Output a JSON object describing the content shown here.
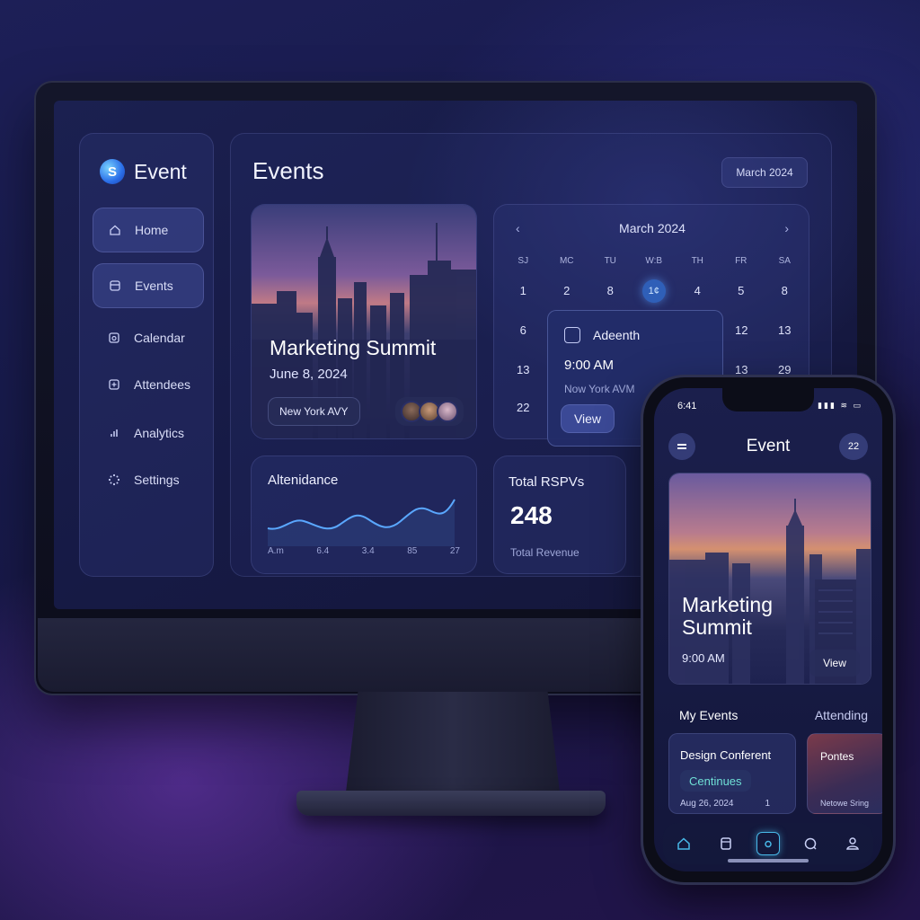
{
  "desktop": {
    "brand": {
      "logo_letter": "S",
      "name": "Event"
    },
    "sidebar": {
      "items": [
        {
          "label": "Home",
          "icon": "home-icon"
        },
        {
          "label": "Events",
          "icon": "events-icon"
        },
        {
          "label": "Calendar",
          "icon": "calendar-icon"
        },
        {
          "label": "Attendees",
          "icon": "attendees-icon"
        },
        {
          "label": "Analytics",
          "icon": "analytics-icon"
        },
        {
          "label": "Settings",
          "icon": "settings-icon"
        }
      ]
    },
    "header": {
      "title": "Events",
      "month_chip": "March 2024"
    },
    "featured_event": {
      "title": "Marketing Summit",
      "date": "June 8, 2024",
      "location": "New York AVY"
    },
    "calendar": {
      "month": "March 2024",
      "prev_icon": "‹",
      "next_icon": "›",
      "weekdays": [
        "SJ",
        "MC",
        "TU",
        "W:B",
        "TH",
        "FR",
        "SA"
      ],
      "row1": [
        "1",
        "2",
        "8",
        "1¢",
        "4",
        "5",
        "8"
      ],
      "left_col": [
        "6",
        "13",
        "22"
      ],
      "right_col_fr": [
        "12",
        "13"
      ],
      "right_col_sa": [
        "13",
        "29"
      ],
      "today_index": 3
    },
    "popover": {
      "name": "Adeenth",
      "time": "9:00 AM",
      "location": "Now York AVM",
      "button": "View"
    },
    "attendance": {
      "title": "Altenidance",
      "axis": [
        "A.m",
        "6.4",
        "3.4",
        "85",
        "27"
      ]
    },
    "rsvp": {
      "title": "Total RSPVs",
      "value": "248",
      "subtitle": "Total Revenue"
    }
  },
  "phone": {
    "time": "6:41",
    "status": "▮▮▮ ≋ ▭",
    "title": "Event",
    "badge": "22",
    "card": {
      "title": "Marketing Summit",
      "time": "9:00 AM",
      "button": "View"
    },
    "tabs": [
      "My Events",
      "Attending"
    ],
    "mini1": {
      "title": "Design Conferent",
      "chip": "Centinues",
      "date": "Aug 26, 2024",
      "count": "1"
    },
    "mini2": {
      "title": "Pontes",
      "subtitle": "Netowe Sring"
    },
    "nav": [
      "home-icon",
      "bookmark-icon",
      "camera-icon",
      "chat-icon",
      "profile-icon"
    ]
  },
  "colors": {
    "accent": "#48b8e8",
    "today": "#2f5fb8",
    "chip_text": "#6fe0d6"
  }
}
